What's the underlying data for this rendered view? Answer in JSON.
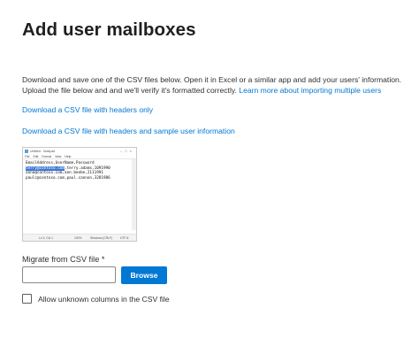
{
  "page": {
    "title": "Add user mailboxes"
  },
  "intro": {
    "line1": "Download and save one of the CSV files below. Open it in Excel or a similar app and add your users' information.",
    "line2_text": "Upload the file below and and we'll verify it's formatted correctly. ",
    "line2_link": "Learn more about importing multiple users"
  },
  "downloads": {
    "headers_only": "Download a CSV file with headers only",
    "headers_and_sample": "Download a CSV file with headers and sample user information"
  },
  "notepad": {
    "title": "Untitled - Notepad",
    "menu": [
      "File",
      "Edit",
      "Format",
      "View",
      "Help"
    ],
    "lines": {
      "header": "EmailAddress,UserName,Password",
      "row1_selected": "terry@contoso.com",
      "row1_rest": ",terry.adams,1091990",
      "row2": "anne@contoso.com,ann.beebe,2111991",
      "row3": "paulc@contoso.com,paul.cannon,3281986"
    },
    "status": {
      "position": "Ln 2, Col 1",
      "zoom": "100%",
      "line_endings": "Windows (CRLF)",
      "encoding": "UTF-8"
    }
  },
  "form": {
    "migrate_label": "Migrate from CSV file *",
    "file_value": "",
    "browse_label": "Browse",
    "allow_unknown_label": "Allow unknown columns in the CSV file",
    "allow_unknown_checked": false
  }
}
